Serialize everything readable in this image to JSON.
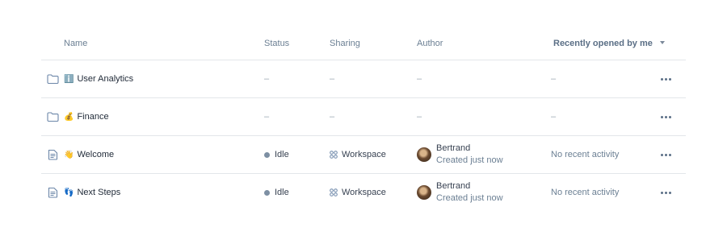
{
  "header": {
    "name": "Name",
    "status": "Status",
    "sharing": "Sharing",
    "author": "Author",
    "sort": "Recently opened by me"
  },
  "rows": [
    {
      "type": "folder",
      "emoji": "ℹ️",
      "name": "User Analytics",
      "status": "–",
      "sharing": "–",
      "author": "–",
      "recent": "–"
    },
    {
      "type": "folder",
      "emoji": "💰",
      "name": "Finance",
      "status": "–",
      "sharing": "–",
      "author": "–",
      "recent": "–"
    },
    {
      "type": "document",
      "emoji": "👋",
      "name": "Welcome",
      "status": "Idle",
      "sharing": "Workspace",
      "author": "Bertrand",
      "author_sub": "Created just now",
      "recent": "No recent activity"
    },
    {
      "type": "document",
      "emoji": "👣",
      "name": "Next Steps",
      "status": "Idle",
      "sharing": "Workspace",
      "author": "Bertrand",
      "author_sub": "Created just now",
      "recent": "No recent activity"
    }
  ],
  "icons": {
    "folder": "folder-icon",
    "document": "document-icon",
    "workspace": "workspace-icon",
    "more": "more-horizontal-icon",
    "sort": "chevron-down-icon"
  },
  "colors": {
    "status_idle": "#7d8fa3",
    "icon": "#6b86a8"
  }
}
